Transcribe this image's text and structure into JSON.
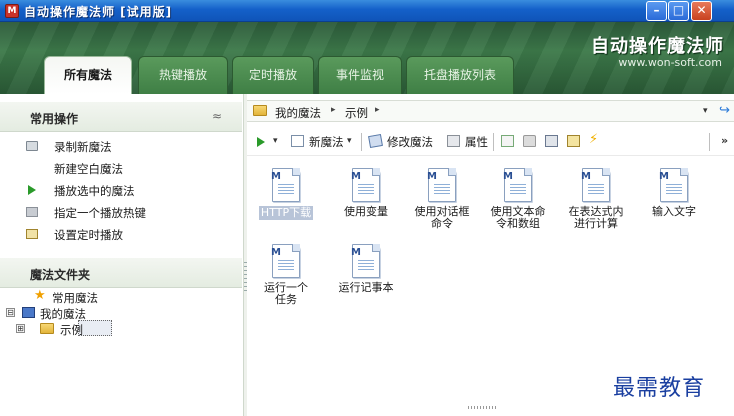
{
  "window": {
    "title": "自动操作魔法师 [试用版]",
    "app_icon": "app-icon",
    "controls": [
      "minimize-icon",
      "maximize-icon",
      "close-icon"
    ]
  },
  "banner": {
    "brand": "自动操作魔法师",
    "url": "www.won-soft.com",
    "tabs": [
      {
        "label": "所有魔法",
        "active": true
      },
      {
        "label": "热键播放",
        "active": false
      },
      {
        "label": "定时播放",
        "active": false
      },
      {
        "label": "事件监视",
        "active": false
      },
      {
        "label": "托盘播放列表",
        "active": false
      }
    ]
  },
  "sidebar": {
    "common_ops_title": "常用操作",
    "collapse_glyph": "≈",
    "ops": [
      {
        "label": "录制新魔法",
        "icon": "record-icon"
      },
      {
        "label": "新建空白魔法",
        "icon": ""
      },
      {
        "label": "播放选中的魔法",
        "icon": "play-icon"
      },
      {
        "label": "指定一个播放热键",
        "icon": "keyboard-icon"
      },
      {
        "label": "设置定时播放",
        "icon": "timer-icon"
      }
    ],
    "folders_title": "魔法文件夹",
    "tree": [
      {
        "label": "常用魔法",
        "icon": "star-icon"
      },
      {
        "label": "我的魔法",
        "icon": "computer-icon",
        "expander": "⊟"
      },
      {
        "label": "示例",
        "icon": "folder-icon",
        "expander": "⊞",
        "selected": true
      }
    ]
  },
  "address": {
    "segments": [
      "我的魔法",
      "示例"
    ],
    "separator": "▸",
    "dropdown": "▾",
    "go_icon": "go-icon"
  },
  "toolbar": {
    "new_label": "新魔法",
    "edit_label": "修改魔法",
    "props_label": "属性",
    "caret": "▾",
    "more": "»"
  },
  "files": [
    {
      "label": "HTTP下载",
      "selected": true
    },
    {
      "label": "使用变量",
      "selected": false
    },
    {
      "label": "使用对话框命令",
      "selected": false
    },
    {
      "label": "使用文本命令和数组",
      "selected": false
    },
    {
      "label": "在表达式内进行计算",
      "selected": false
    },
    {
      "label": "输入文字",
      "selected": false
    },
    {
      "label": "运行一个任务",
      "selected": false
    },
    {
      "label": "运行记事本",
      "selected": false
    }
  ],
  "watermark": "最需教育",
  "colors": {
    "titlebar": "#1460c9",
    "banner": "#3d7a4a",
    "accent_green": "#2a9a2a",
    "watermark": "#1a3fa0"
  }
}
